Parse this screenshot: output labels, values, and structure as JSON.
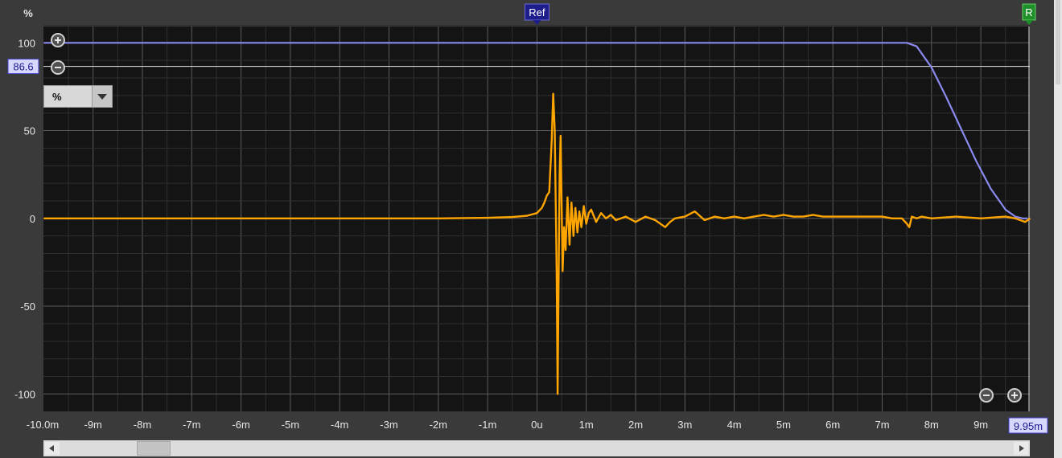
{
  "y_unit_label": "%",
  "ref_marker_label": "Ref",
  "r_marker_label": "R",
  "y_cursor_value": "86.6",
  "x_cursor_value": "9.95m",
  "unit_dropdown_value": "%",
  "colors": {
    "background": "#3a3a3a",
    "plot_background": "#141414",
    "grid": "#4a4a4a",
    "impulse": "#ffa500",
    "window": "#8a8af0",
    "ref_marker": "#1d1d8c",
    "r_marker": "#1f8f2a"
  },
  "chart_data": {
    "type": "line",
    "title": "",
    "xlabel": "",
    "ylabel": "%",
    "xlim": [
      -10.0,
      10.0
    ],
    "ylim": [
      -105,
      110
    ],
    "x_unit": "ms",
    "x_ticks": [
      -10,
      -9,
      -8,
      -7,
      -6,
      -5,
      -4,
      -3,
      -2,
      -1,
      0,
      1,
      2,
      3,
      4,
      5,
      6,
      7,
      8,
      9
    ],
    "x_tick_labels": [
      "-10.0m",
      "-9m",
      "-8m",
      "-7m",
      "-6m",
      "-5m",
      "-4m",
      "-3m",
      "-2m",
      "-1m",
      "0u",
      "1m",
      "2m",
      "3m",
      "4m",
      "5m",
      "6m",
      "7m",
      "8m",
      "9m"
    ],
    "y_ticks": [
      100,
      50,
      0,
      -50,
      -100
    ],
    "y_tick_labels": [
      "100",
      "50",
      "0",
      "-50",
      "-100"
    ],
    "grid": true,
    "ref_time": 0,
    "cursor_level": 86.6,
    "series": [
      {
        "role": "impulse",
        "x": [
          -10.0,
          -2.0,
          -1.0,
          -0.5,
          -0.2,
          0.0,
          0.1,
          0.15,
          0.2,
          0.25,
          0.3,
          0.33,
          0.36,
          0.38,
          0.4,
          0.42,
          0.44,
          0.46,
          0.48,
          0.5,
          0.52,
          0.55,
          0.58,
          0.62,
          0.66,
          0.7,
          0.74,
          0.78,
          0.82,
          0.86,
          0.9,
          0.95,
          1.0,
          1.05,
          1.1,
          1.2,
          1.3,
          1.4,
          1.5,
          1.6,
          1.8,
          2.0,
          2.2,
          2.4,
          2.6,
          2.7,
          2.8,
          3.0,
          3.2,
          3.4,
          3.6,
          3.8,
          4.0,
          4.2,
          4.4,
          4.6,
          4.8,
          5.0,
          5.2,
          5.4,
          5.6,
          5.8,
          6.0,
          6.5,
          7.0,
          7.2,
          7.4,
          7.5,
          7.55,
          7.6,
          7.7,
          7.8,
          8.0,
          8.5,
          9.0,
          9.5,
          9.7,
          9.8,
          9.9,
          10.0
        ],
        "y": [
          0,
          0,
          0.3,
          0.8,
          1.5,
          3,
          6,
          9,
          13,
          15,
          45,
          71,
          50,
          10,
          -30,
          -100,
          -30,
          25,
          47,
          10,
          -30,
          -5,
          -18,
          12,
          -15,
          9,
          -10,
          6,
          -8,
          4,
          -5,
          7,
          -3,
          3,
          5,
          -2,
          3,
          0,
          2,
          -1,
          1,
          -2,
          1,
          -1,
          -5,
          -2,
          0,
          1,
          4,
          -1,
          1,
          0,
          1,
          0,
          1,
          2,
          1,
          2,
          1,
          1,
          2,
          1,
          1,
          1,
          1,
          0,
          0,
          -3,
          -5,
          1,
          0,
          1,
          0,
          1,
          0,
          1,
          0,
          -1,
          -2,
          0
        ]
      },
      {
        "role": "window",
        "x": [
          -10.0,
          7.5,
          7.7,
          8.0,
          8.3,
          8.6,
          8.9,
          9.2,
          9.5,
          9.7,
          9.85,
          9.95
        ],
        "y": [
          100,
          100,
          98,
          86,
          69,
          51,
          33,
          17,
          5,
          1,
          0,
          0
        ]
      }
    ]
  }
}
